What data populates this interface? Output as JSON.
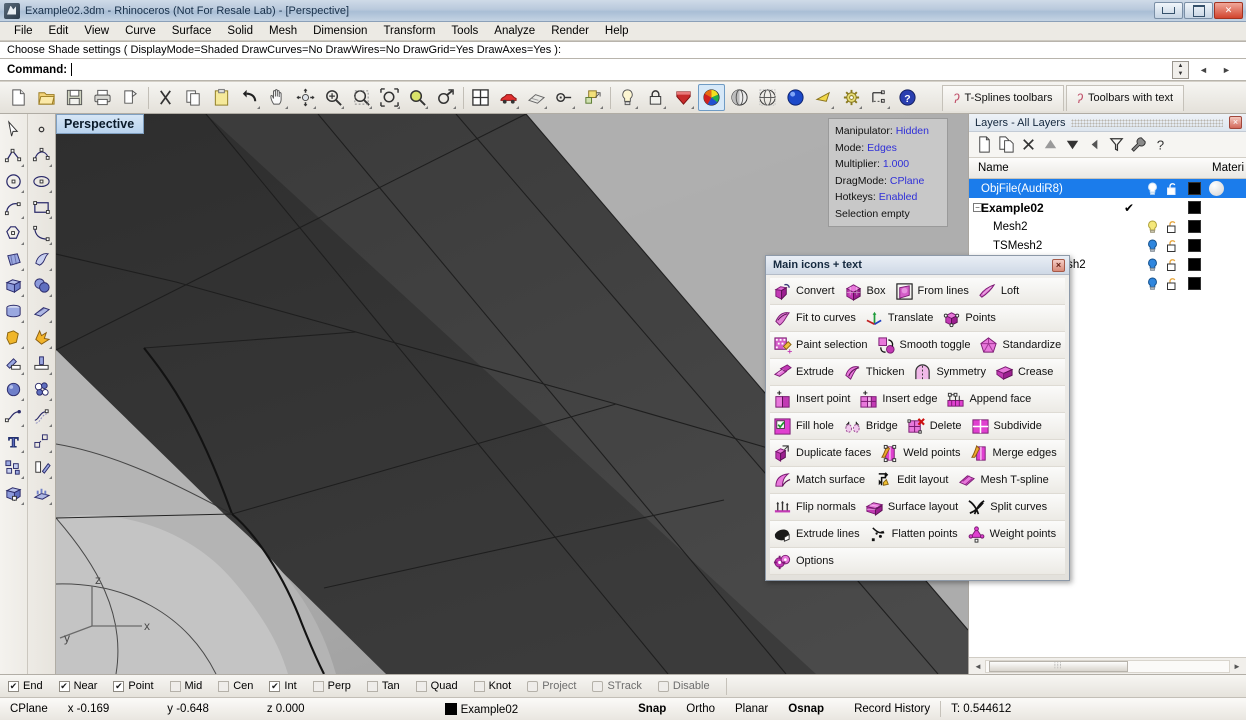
{
  "window": {
    "title": "Example02.3dm - Rhinoceros (Not For Resale Lab) - [Perspective]",
    "minimize_label": "Minimize",
    "restore_label": "Restore",
    "close_label": "Close"
  },
  "menu": {
    "items": [
      "File",
      "Edit",
      "View",
      "Curve",
      "Surface",
      "Solid",
      "Mesh",
      "Dimension",
      "Transform",
      "Tools",
      "Analyze",
      "Render",
      "Help"
    ]
  },
  "command": {
    "history": "Choose Shade settings ( DisplayMode=Shaded  DrawCurves=No  DrawWires=No  DrawGrid=Yes  DrawAxes=Yes ):",
    "prompt_label": "Command:",
    "prompt_value": "",
    "scroll_up": "▲",
    "scroll_down": "▼",
    "nav_prev": "◄",
    "nav_next": "►"
  },
  "main_toolbar": {
    "buttons": [
      {
        "name": "new-file",
        "label": "New"
      },
      {
        "name": "open-file",
        "label": "Open"
      },
      {
        "name": "save-file",
        "label": "Save"
      },
      {
        "name": "print",
        "label": "Print"
      },
      {
        "name": "copy-to-clipboard",
        "label": "Copy to clipboard"
      },
      {
        "name": "cut",
        "label": "Cut"
      },
      {
        "name": "copy",
        "label": "Copy"
      },
      {
        "name": "paste",
        "label": "Paste"
      },
      {
        "name": "undo",
        "label": "Undo"
      },
      {
        "name": "pan",
        "label": "Pan"
      },
      {
        "name": "zoom-dynamic",
        "label": "Zoom dynamic"
      },
      {
        "name": "zoom-in",
        "label": "Zoom in"
      },
      {
        "name": "zoom-window",
        "label": "Zoom window"
      },
      {
        "name": "zoom-extents",
        "label": "Zoom extents"
      },
      {
        "name": "zoom-selected",
        "label": "Zoom selected"
      },
      {
        "name": "zoom-previous",
        "label": "Zoom previous"
      },
      {
        "name": "viewport-layout",
        "label": "Viewport layout"
      },
      {
        "name": "render",
        "label": "Render"
      },
      {
        "name": "render-preview",
        "label": "Render preview"
      },
      {
        "name": "properties",
        "label": "Properties"
      },
      {
        "name": "layers",
        "label": "Layers"
      },
      {
        "name": "light",
        "label": "Light"
      },
      {
        "name": "lock",
        "label": "Lock"
      },
      {
        "name": "shade",
        "label": "Shade"
      },
      {
        "name": "rendered-display",
        "label": "Rendered display"
      },
      {
        "name": "shaded-display",
        "label": "Shaded display"
      },
      {
        "name": "ghosted-display",
        "label": "Ghosted display"
      },
      {
        "name": "render-sphere",
        "label": "Render"
      },
      {
        "name": "flat-shade",
        "label": "Flat shade"
      },
      {
        "name": "options-gear",
        "label": "Options"
      },
      {
        "name": "dimension",
        "label": "Dimension"
      },
      {
        "name": "help",
        "label": "Help"
      }
    ],
    "tabs": [
      {
        "label": "T-Splines toolbars"
      },
      {
        "label": "Toolbars with text"
      }
    ]
  },
  "left_toolbar": {
    "column_a": [
      {
        "name": "select-arrow",
        "label": "Select"
      },
      {
        "name": "polyline",
        "label": "Polyline"
      },
      {
        "name": "circle",
        "label": "Circle"
      },
      {
        "name": "arc",
        "label": "Arc"
      },
      {
        "name": "polygon",
        "label": "Polygon"
      },
      {
        "name": "surface-from-curves",
        "label": "Surface from curves"
      },
      {
        "name": "box",
        "label": "Box"
      },
      {
        "name": "cylinder",
        "label": "Cylinder"
      },
      {
        "name": "boolean-union",
        "label": "Boolean union"
      },
      {
        "name": "fillet-edge",
        "label": "Fillet edge"
      },
      {
        "name": "sphere-small",
        "label": "Sphere"
      },
      {
        "name": "curve-edit",
        "label": "Curve edit"
      },
      {
        "name": "text",
        "label": "Text"
      },
      {
        "name": "array",
        "label": "Array"
      },
      {
        "name": "mesh-box",
        "label": "Mesh box"
      }
    ],
    "column_b": [
      {
        "name": "point",
        "label": "Point"
      },
      {
        "name": "curve-control-points",
        "label": "Control point curve"
      },
      {
        "name": "ellipse",
        "label": "Ellipse"
      },
      {
        "name": "rectangle",
        "label": "Rectangle"
      },
      {
        "name": "curve-interpolate",
        "label": "Interpolate curve"
      },
      {
        "name": "surface-patch",
        "label": "Surface patch"
      },
      {
        "name": "sphere",
        "label": "Sphere"
      },
      {
        "name": "surface-plane",
        "label": "Surface plane"
      },
      {
        "name": "explode",
        "label": "Explode"
      },
      {
        "name": "extrude-planar",
        "label": "Extrude planar"
      },
      {
        "name": "boolean-ops",
        "label": "Boolean operations"
      },
      {
        "name": "offset-curve",
        "label": "Offset curve"
      },
      {
        "name": "scale",
        "label": "Scale"
      },
      {
        "name": "rotate",
        "label": "Rotate"
      },
      {
        "name": "mesh-tools",
        "label": "Mesh tools"
      }
    ]
  },
  "viewport": {
    "label": "Perspective",
    "axes": {
      "z": "z",
      "y": "y",
      "x": "x"
    },
    "info": [
      {
        "key": "Manipulator:",
        "value": "Hidden"
      },
      {
        "key": "Mode:",
        "value": "Edges"
      },
      {
        "key": "Multiplier:",
        "value": "1.000"
      },
      {
        "key": "DragMode:",
        "value": "CPlane"
      },
      {
        "key": "Hotkeys:",
        "value": "Enabled"
      }
    ],
    "selection_status": "Selection empty"
  },
  "float_panel": {
    "title": "Main icons + text",
    "close_label": "×",
    "rows": [
      [
        {
          "name": "convert",
          "label": "Convert",
          "icon": "convert-icon"
        },
        {
          "name": "box",
          "label": "Box",
          "icon": "box-icon"
        },
        {
          "name": "from-lines",
          "label": "From lines",
          "icon": "from-lines-icon"
        },
        {
          "name": "loft",
          "label": "Loft",
          "icon": "loft-icon"
        }
      ],
      [
        {
          "name": "fit-to-curves",
          "label": "Fit to curves",
          "icon": "fit-to-curves-icon"
        },
        {
          "name": "translate",
          "label": "Translate",
          "icon": "translate-icon"
        },
        {
          "name": "points",
          "label": "Points",
          "icon": "points-icon"
        }
      ],
      [
        {
          "name": "paint-selection",
          "label": "Paint selection",
          "icon": "paint-selection-icon"
        },
        {
          "name": "smooth-toggle",
          "label": "Smooth toggle",
          "icon": "smooth-toggle-icon"
        },
        {
          "name": "standardize",
          "label": "Standardize",
          "icon": "standardize-icon"
        }
      ],
      [
        {
          "name": "extrude",
          "label": "Extrude",
          "icon": "extrude-icon"
        },
        {
          "name": "thicken",
          "label": "Thicken",
          "icon": "thicken-icon"
        },
        {
          "name": "symmetry",
          "label": "Symmetry",
          "icon": "symmetry-icon"
        },
        {
          "name": "crease",
          "label": "Crease",
          "icon": "crease-icon"
        }
      ],
      [
        {
          "name": "insert-point",
          "label": "Insert point",
          "icon": "insert-point-icon"
        },
        {
          "name": "insert-edge",
          "label": "Insert edge",
          "icon": "insert-edge-icon"
        },
        {
          "name": "append-face",
          "label": "Append face",
          "icon": "append-face-icon"
        }
      ],
      [
        {
          "name": "fill-hole",
          "label": "Fill hole",
          "icon": "fill-hole-icon"
        },
        {
          "name": "bridge",
          "label": "Bridge",
          "icon": "bridge-icon"
        },
        {
          "name": "delete",
          "label": "Delete",
          "icon": "delete-icon"
        },
        {
          "name": "subdivide",
          "label": "Subdivide",
          "icon": "subdivide-icon"
        }
      ],
      [
        {
          "name": "duplicate-faces",
          "label": "Duplicate faces",
          "icon": "duplicate-faces-icon"
        },
        {
          "name": "weld-points",
          "label": "Weld points",
          "icon": "weld-points-icon"
        },
        {
          "name": "merge-edges",
          "label": "Merge edges",
          "icon": "merge-edges-icon"
        }
      ],
      [
        {
          "name": "match-surface",
          "label": "Match surface",
          "icon": "match-surface-icon"
        },
        {
          "name": "edit-layout",
          "label": "Edit layout",
          "icon": "edit-layout-icon"
        },
        {
          "name": "mesh-t-spline",
          "label": "Mesh T-spline",
          "icon": "mesh-t-spline-icon"
        }
      ],
      [
        {
          "name": "flip-normals",
          "label": "Flip normals",
          "icon": "flip-normals-icon"
        },
        {
          "name": "surface-layout",
          "label": "Surface layout",
          "icon": "surface-layout-icon"
        },
        {
          "name": "split-curves",
          "label": "Split curves",
          "icon": "split-curves-icon"
        }
      ],
      [
        {
          "name": "extrude-lines",
          "label": "Extrude lines",
          "icon": "extrude-lines-icon"
        },
        {
          "name": "flatten-points",
          "label": "Flatten points",
          "icon": "flatten-points-icon"
        },
        {
          "name": "weight-points",
          "label": "Weight points",
          "icon": "weight-points-icon"
        }
      ],
      [
        {
          "name": "options",
          "label": "Options",
          "icon": "options-icon"
        }
      ]
    ]
  },
  "layers_panel": {
    "title": "Layers - All Layers",
    "close_label": "×",
    "toolbar": [
      {
        "name": "new-layer",
        "label": "New layer"
      },
      {
        "name": "new-sublayer",
        "label": "New sublayer"
      },
      {
        "name": "delete-layer",
        "label": "Delete"
      },
      {
        "name": "move-up",
        "label": "Move up"
      },
      {
        "name": "move-down",
        "label": "Move down"
      },
      {
        "name": "move-back",
        "label": "Move back"
      },
      {
        "name": "filter",
        "label": "Filter"
      },
      {
        "name": "layer-tools",
        "label": "Layer tools"
      },
      {
        "name": "help",
        "label": "?"
      }
    ],
    "columns": {
      "name": "Name",
      "material": "Materi"
    },
    "rows": [
      {
        "name": "ObjFile(AudiR8)",
        "indent": 0,
        "selected": true,
        "current": false,
        "bulb": "white",
        "lock": "unlocked",
        "color": "#000000",
        "material": true,
        "expander": null,
        "bold": false
      },
      {
        "name": "Example02",
        "indent": 0,
        "selected": false,
        "current": true,
        "bulb": "none",
        "lock": "none",
        "color": "#000000",
        "material": false,
        "expander": "−",
        "bold": true
      },
      {
        "name": "Mesh2",
        "indent": 1,
        "selected": false,
        "current": false,
        "bulb": "yellow",
        "lock": "unlocked",
        "color": "#000000",
        "material": false,
        "expander": null,
        "bold": false
      },
      {
        "name": "TSMesh2",
        "indent": 1,
        "selected": false,
        "current": false,
        "bulb": "blue",
        "lock": "unlocked",
        "color": "#000000",
        "material": false,
        "expander": null,
        "bold": false
      },
      {
        "name": "ModifiedTSMesh2",
        "indent": 1,
        "selected": false,
        "current": false,
        "bulb": "blue",
        "lock": "unlocked",
        "color": "#000000",
        "material": false,
        "expander": null,
        "bold": false
      },
      {
        "name": "",
        "indent": 1,
        "selected": false,
        "current": false,
        "bulb": "blue",
        "lock": "unlocked",
        "color": "#000000",
        "material": false,
        "expander": null,
        "bold": false
      }
    ],
    "scroll_left": "◄",
    "scroll_right": "►"
  },
  "osnap_bar": {
    "items": [
      {
        "label": "End",
        "checked": true
      },
      {
        "label": "Near",
        "checked": true
      },
      {
        "label": "Point",
        "checked": true
      },
      {
        "label": "Mid",
        "checked": false
      },
      {
        "label": "Cen",
        "checked": false
      },
      {
        "label": "Int",
        "checked": true
      },
      {
        "label": "Perp",
        "checked": false
      },
      {
        "label": "Tan",
        "checked": false
      },
      {
        "label": "Quad",
        "checked": false
      },
      {
        "label": "Knot",
        "checked": false
      },
      {
        "label": "Project",
        "checked": false
      },
      {
        "label": "STrack",
        "checked": false
      },
      {
        "label": "Disable",
        "checked": false
      }
    ]
  },
  "status_bar": {
    "cplane": "CPlane",
    "x": "x -0.169",
    "y": "y -0.648",
    "z": "z 0.000",
    "layer": "Example02",
    "layer_color": "#000000",
    "toggles": [
      {
        "label": "Snap",
        "on": true
      },
      {
        "label": "Ortho",
        "on": false
      },
      {
        "label": "Planar",
        "on": false
      },
      {
        "label": "Osnap",
        "on": true
      },
      {
        "label": "Record History",
        "on": false
      }
    ],
    "time": "T: 0.544612"
  }
}
